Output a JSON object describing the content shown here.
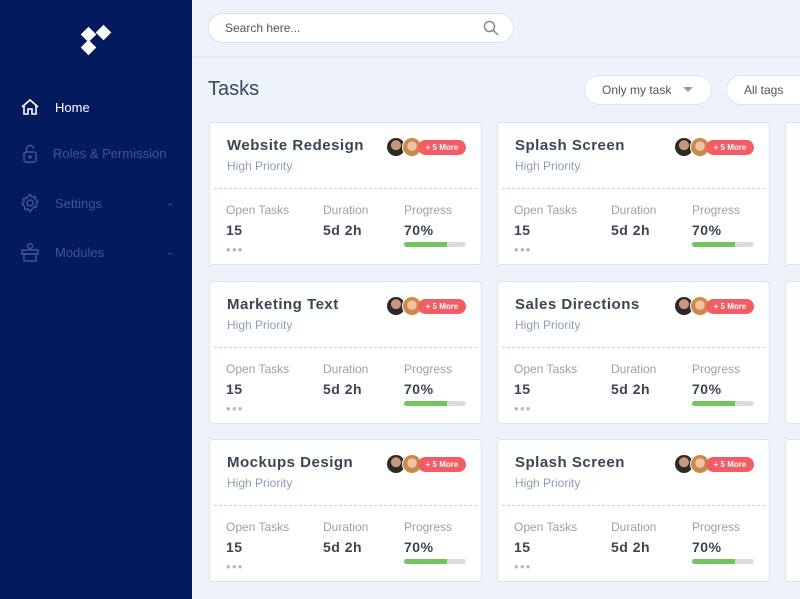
{
  "sidebar": {
    "items": [
      {
        "label": "Home",
        "icon": "home-icon",
        "active": true
      },
      {
        "label": "Roles & Permission",
        "icon": "lock-icon"
      },
      {
        "label": "Settings",
        "icon": "gear-icon",
        "chevron": true
      },
      {
        "label": "Modules",
        "icon": "modules-icon",
        "chevron": true
      }
    ]
  },
  "search": {
    "placeholder": "Search here..."
  },
  "page": {
    "title": "Tasks"
  },
  "filters": {
    "mine": "Only my task",
    "tags": "All tags"
  },
  "colors": {
    "sidebar": "#031a5e",
    "badge": "#f55b63",
    "progress": "#72c45d"
  },
  "labels": {
    "open": "Open Tasks",
    "duration": "Duration",
    "progress": "Progress"
  },
  "cards": [
    {
      "name": "Website Redesign",
      "priority": "High Priority",
      "more": "+ 5 More",
      "open": "15",
      "duration": "5d 2h",
      "progress": "70%",
      "progress_value": 70
    },
    {
      "name": "Splash Screen",
      "priority": "High Priority",
      "more": "+ 5 More",
      "open": "15",
      "duration": "5d 2h",
      "progress": "70%",
      "progress_value": 70
    },
    {
      "name": "Marketing Text",
      "priority": "High Priority",
      "more": "+ 5 More",
      "open": "15",
      "duration": "5d 2h",
      "progress": "70%",
      "progress_value": 70
    },
    {
      "name": "Sales Directions",
      "priority": "High Priority",
      "more": "+ 5 More",
      "open": "15",
      "duration": "5d 2h",
      "progress": "70%",
      "progress_value": 70
    },
    {
      "name": "Mockups Design",
      "priority": "High Priority",
      "more": "+ 5 More",
      "open": "15",
      "duration": "5d 2h",
      "progress": "70%",
      "progress_value": 70
    },
    {
      "name": "Splash Screen",
      "priority": "High Priority",
      "more": "+ 5 More",
      "open": "15",
      "duration": "5d 2h",
      "progress": "70%",
      "progress_value": 70
    }
  ]
}
